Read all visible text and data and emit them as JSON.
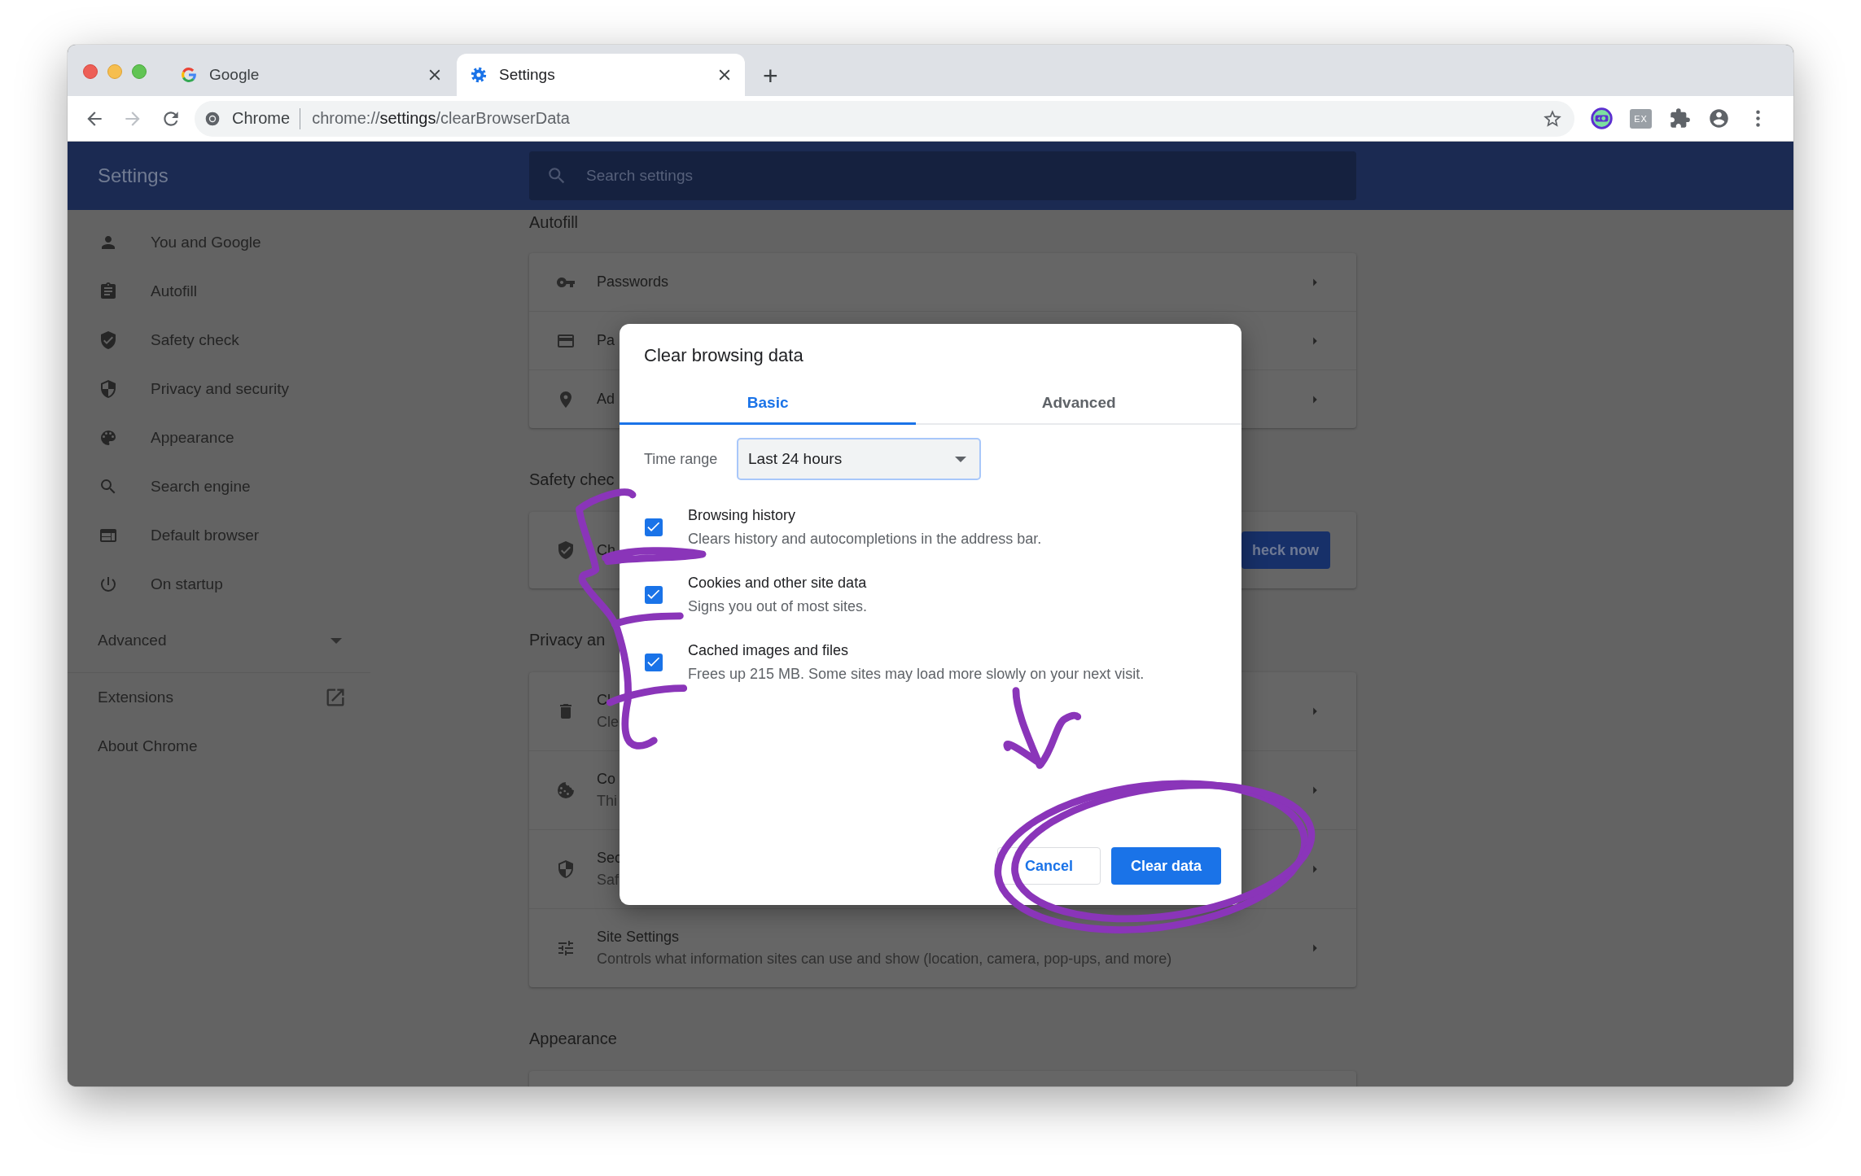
{
  "browser": {
    "tabs": [
      {
        "kind": "google",
        "title": "Google",
        "selected": false
      },
      {
        "kind": "settings",
        "title": "Settings",
        "selected": true
      }
    ],
    "new_tab": "+",
    "nav": [
      {
        "kind": "back",
        "disabled": false
      },
      {
        "kind": "forward",
        "disabled": true
      },
      {
        "kind": "reload",
        "disabled": false
      }
    ],
    "address": {
      "site": "Chrome",
      "url": "chrome://**settings**/clearBrowserData"
    },
    "toolbar_icons": [
      {
        "kind": "round-extension"
      },
      {
        "kind": "badge",
        "label": "EX"
      },
      {
        "kind": "puzzle"
      },
      {
        "kind": "profile"
      },
      {
        "kind": "menu"
      }
    ]
  },
  "settings": {
    "title": "Settings",
    "search": {
      "placeholder": "Search settings"
    },
    "sidebar": {
      "items": [
        {
          "kind": "person",
          "label": "You and Google"
        },
        {
          "kind": "clipboard",
          "label": "Autofill"
        },
        {
          "kind": "shield-check",
          "label": "Safety check"
        },
        {
          "kind": "shield-half",
          "label": "Privacy and security"
        },
        {
          "kind": "palette",
          "label": "Appearance"
        },
        {
          "kind": "search",
          "label": "Search engine"
        },
        {
          "kind": "browser",
          "label": "Default browser"
        },
        {
          "kind": "power",
          "label": "On startup"
        }
      ],
      "advanced": {
        "label": "Advanced",
        "expanded": false
      },
      "links": [
        {
          "label": "Extensions",
          "external": true
        },
        {
          "label": "About Chrome",
          "external": false
        }
      ]
    },
    "sections": [
      {
        "heading": "Autofill",
        "rows": [
          {
            "kind": "key",
            "title": "Passwords"
          },
          {
            "kind": "card",
            "title": "Pa"
          },
          {
            "kind": "pin",
            "title": "Ad"
          }
        ]
      },
      {
        "heading": "Safety chec",
        "rows": [
          {
            "kind": "shield-check",
            "title": "Ch",
            "button": "heck now"
          }
        ]
      },
      {
        "heading": "Privacy an",
        "rows": [
          {
            "kind": "trash",
            "title": "Cl",
            "subtitle": "Cle"
          },
          {
            "kind": "cookie",
            "title": "Co",
            "subtitle": "Thi"
          },
          {
            "kind": "shield-half",
            "title": "Sec",
            "subtitle": "Saf"
          },
          {
            "kind": "tune",
            "title": "Site Settings",
            "subtitle": "Controls what information sites can use and show (location, camera, pop-ups, and more)"
          }
        ]
      },
      {
        "heading": "Appearance"
      }
    ]
  },
  "dialog": {
    "title": "Clear browsing data",
    "tabs": [
      {
        "label": "Basic",
        "selected": true
      },
      {
        "label": "Advanced",
        "selected": false
      }
    ],
    "time_range": {
      "label": "Time range",
      "value": "Last 24 hours"
    },
    "options": [
      {
        "title": "Browsing history",
        "description": "Clears history and autocompletions in the address bar.",
        "checked": true
      },
      {
        "title": "Cookies and other site data",
        "description": "Signs you out of most sites.",
        "checked": true
      },
      {
        "title": "Cached images and files",
        "description": "Frees up 215 MB. Some sites may load more slowly on your next visit.",
        "checked": true
      }
    ],
    "buttons": [
      {
        "label": "Cancel",
        "kind": "secondary"
      },
      {
        "label": "Clear data",
        "kind": "primary"
      }
    ]
  }
}
